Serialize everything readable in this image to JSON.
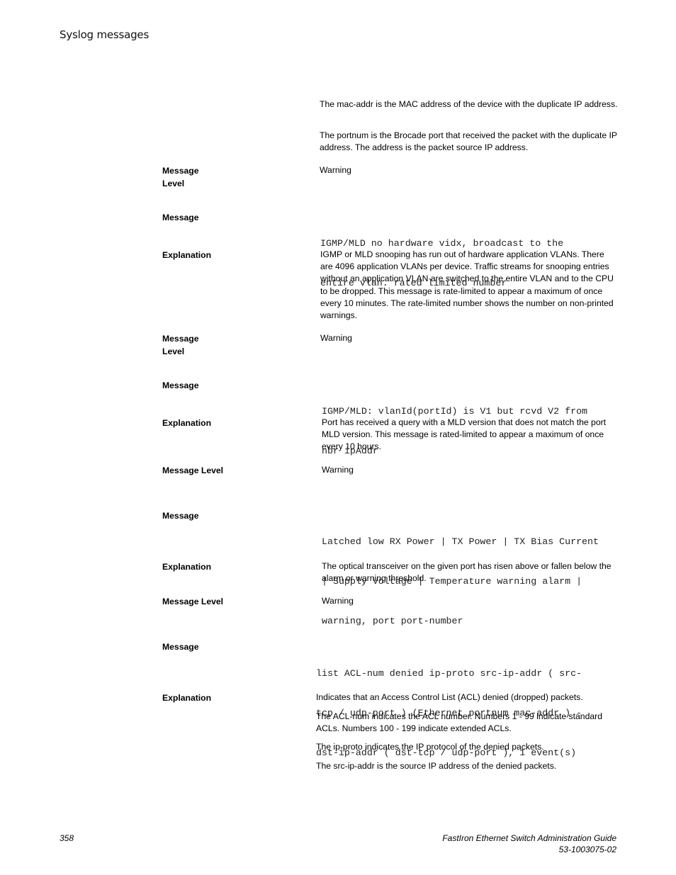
{
  "header": {
    "title": "Syslog messages"
  },
  "intro_paragraphs": [
    "The mac-addr is the MAC address of the device with the duplicate IP address.",
    "The portnum is the Brocade port that received the packet with the duplicate IP address. The address is the packet source IP address."
  ],
  "labels": {
    "message_level_wrapped_1": "Message",
    "message_level_wrapped_2": "Level",
    "message": "Message",
    "explanation": "Explanation",
    "message_level": "Message Level"
  },
  "entries": [
    {
      "level": "Warning"
    },
    {
      "message_lines": [
        "IGMP/MLD no hardware vidx, broadcast to the",
        "entire vlan. rated limited number"
      ],
      "explanation": "IGMP or MLD snooping has run out of hardware application VLANs. There are 4096 application VLANs per device. Traffic streams for snooping entries without an application VLAN are switched to the entire VLAN and to the CPU to be dropped. This message is rate-limited to appear a maximum of once every 10 minutes. The rate-limited number shows the number on non-printed warnings.",
      "level": "Warning"
    },
    {
      "message_lines": [
        "IGMP/MLD: vlanId(portId) is V1 but rcvd V2 from",
        "nbr ipAddr"
      ],
      "explanation": "Port has received a query with a MLD version that does not match the port MLD version. This message is rated-limited to appear a maximum of once every 10 hours.",
      "level": "Warning"
    },
    {
      "message_lines": [
        "Latched low RX Power | TX Power | TX Bias Current",
        "| Supply Voltage | Temperature warning alarm |",
        "warning, port port-number"
      ],
      "explanation": "The optical transceiver on the given port has risen above or fallen below the alarm or warning threshold.",
      "level": "Warning"
    },
    {
      "message_lines": [
        "list ACL-num denied ip-proto src-ip-addr ( src-",
        "tcp / udp-port ) (Ethernet portnum mac-addr ) -",
        "dst-ip-addr ( dst-tcp / udp-port ), 1 event(s)"
      ],
      "explanation_paragraphs": [
        "Indicates that an Access Control List (ACL) denied (dropped) packets.",
        "The ACL-num indicates the ACL number. Numbers 1 - 99 indicate standard ACLs. Numbers 100 - 199 indicate extended ACLs.",
        "The ip-proto indicates the IP protocol of the denied packets.",
        "The src-ip-addr is the source IP address of the denied packets."
      ]
    }
  ],
  "footer": {
    "page_number": "358",
    "guide_title": "FastIron Ethernet Switch Administration Guide",
    "doc_number": "53-1003075-02"
  }
}
